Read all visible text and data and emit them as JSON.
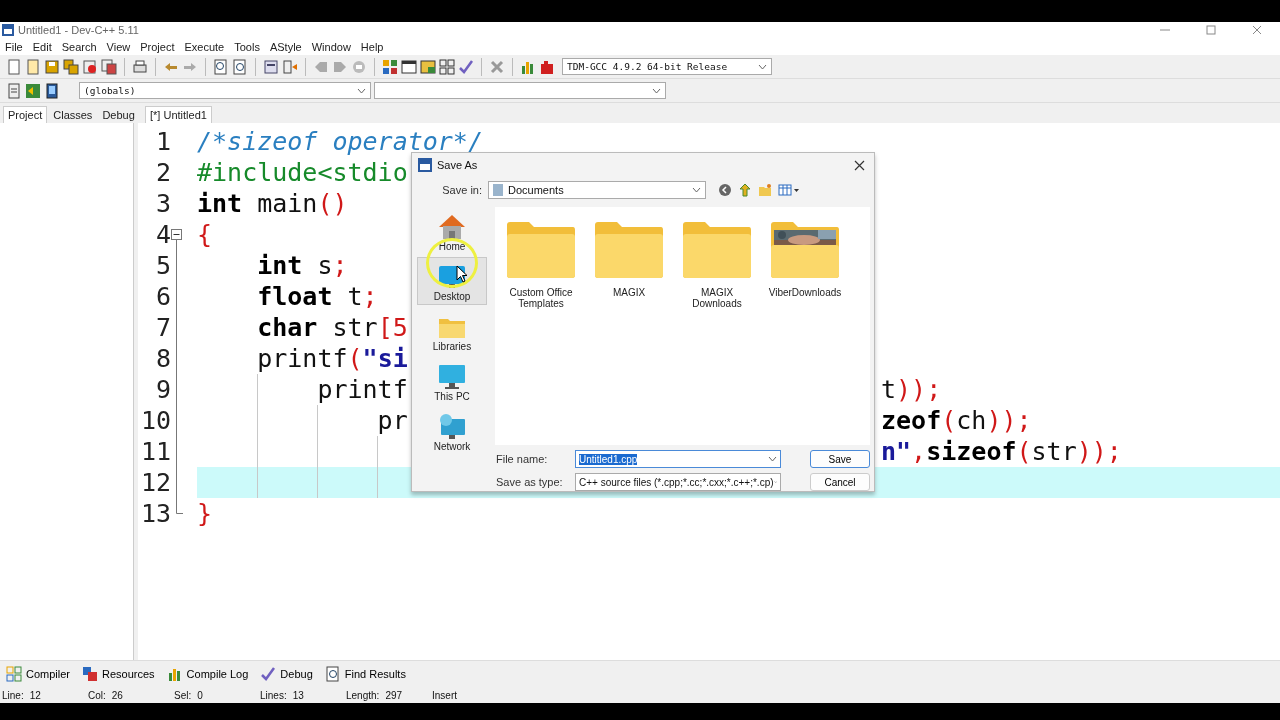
{
  "window": {
    "title": "Untitled1 - Dev-C++ 5.11"
  },
  "menu": [
    "File",
    "Edit",
    "Search",
    "View",
    "Project",
    "Execute",
    "Tools",
    "AStyle",
    "Window",
    "Help"
  ],
  "compiler_select": {
    "value": "TDM-GCC 4.9.2 64-bit Release"
  },
  "scope_select": {
    "value": "(globals)"
  },
  "side_tabs": [
    {
      "label": "Project",
      "selected": true
    },
    {
      "label": "Classes",
      "selected": false
    },
    {
      "label": "Debug",
      "selected": false
    }
  ],
  "editor_tabs": [
    {
      "label": "[*] Untitled1",
      "selected": true
    }
  ],
  "editor": {
    "lines": [
      {
        "number": "1",
        "current": false,
        "left": [
          {
            "kind": "comment",
            "text": "/*sizeof operator*/"
          }
        ]
      },
      {
        "number": "2",
        "current": false,
        "left": [
          {
            "kind": "pre",
            "text": "#include<stdio"
          }
        ]
      },
      {
        "number": "3",
        "current": false,
        "left": [
          {
            "kind": "kw",
            "text": "int"
          },
          {
            "kind": "plain",
            "text": " main"
          },
          {
            "kind": "punct",
            "text": "()"
          }
        ]
      },
      {
        "number": "4",
        "current": false,
        "expanded": true,
        "left": [
          {
            "kind": "punct",
            "text": "{"
          }
        ]
      },
      {
        "number": "5",
        "current": false,
        "left": [
          {
            "kind": "kw",
            "text": "    int"
          },
          {
            "kind": "plain",
            "text": " s"
          },
          {
            "kind": "punct",
            "text": ";"
          }
        ]
      },
      {
        "number": "6",
        "current": false,
        "left": [
          {
            "kind": "kw",
            "text": "    float"
          },
          {
            "kind": "plain",
            "text": " t"
          },
          {
            "kind": "punct",
            "text": ";"
          }
        ]
      },
      {
        "number": "7",
        "current": false,
        "left": [
          {
            "kind": "kw",
            "text": "    char"
          },
          {
            "kind": "plain",
            "text": " str"
          },
          {
            "kind": "punct",
            "text": "[5"
          }
        ]
      },
      {
        "number": "8",
        "current": false,
        "left": [
          {
            "kind": "plain",
            "text": "    printf"
          },
          {
            "kind": "punct",
            "text": "("
          },
          {
            "kind": "str",
            "text": "\"si"
          }
        ]
      },
      {
        "number": "9",
        "current": false,
        "left": [
          {
            "kind": "plain",
            "text": "        printf"
          }
        ],
        "right": [
          {
            "kind": "plain",
            "text": "t"
          },
          {
            "kind": "punct",
            "text": "));"
          }
        ]
      },
      {
        "number": "10",
        "current": false,
        "left": [
          {
            "kind": "plain",
            "text": "            pr"
          }
        ],
        "right": [
          {
            "kind": "kw",
            "text": "zeof"
          },
          {
            "kind": "punct",
            "text": "("
          },
          {
            "kind": "plain",
            "text": "ch"
          },
          {
            "kind": "punct",
            "text": "));"
          }
        ]
      },
      {
        "number": "11",
        "current": false,
        "right": [
          {
            "kind": "str",
            "text": "n\""
          },
          {
            "kind": "punct",
            "text": ","
          },
          {
            "kind": "kw",
            "text": "sizeof"
          },
          {
            "kind": "punct",
            "text": "("
          },
          {
            "kind": "plain",
            "text": "str"
          },
          {
            "kind": "punct",
            "text": "));"
          }
        ]
      },
      {
        "number": "12",
        "current": true
      },
      {
        "number": "13",
        "current": false,
        "left": [
          {
            "kind": "punct",
            "text": "}"
          }
        ]
      }
    ]
  },
  "bottom_tabs": [
    {
      "label": "Compiler"
    },
    {
      "label": "Resources"
    },
    {
      "label": "Compile Log"
    },
    {
      "label": "Debug"
    },
    {
      "label": "Find Results"
    }
  ],
  "status_bar": [
    {
      "label": "Line:",
      "value": "12"
    },
    {
      "label": "Col:",
      "value": "26"
    },
    {
      "label": "Sel:",
      "value": "0"
    },
    {
      "label": "Lines:",
      "value": "13"
    },
    {
      "label": "Length:",
      "value": "297"
    },
    {
      "label": "Insert"
    }
  ],
  "dialog": {
    "title": "Save As",
    "save_in": {
      "label": "Save in:",
      "value": "Documents"
    },
    "places": [
      {
        "kind": "home",
        "label": "Home",
        "selected": false
      },
      {
        "kind": "desktop",
        "label": "Desktop",
        "selected": true
      },
      {
        "kind": "libraries",
        "label": "Libraries",
        "selected": false
      },
      {
        "kind": "pc",
        "label": "This PC",
        "selected": false
      },
      {
        "kind": "network",
        "label": "Network",
        "selected": false
      }
    ],
    "items": [
      {
        "kind": "folder",
        "name": "Custom Office Templates"
      },
      {
        "kind": "folder",
        "name": "MAGIX"
      },
      {
        "kind": "folder",
        "name": "MAGIX Downloads"
      },
      {
        "kind": "picture-folder",
        "name": "ViberDownloads"
      }
    ],
    "file_name": {
      "label": "File name:",
      "value": "Untitled1.cpp",
      "text_selected": true
    },
    "file_type": {
      "label": "Save as type:",
      "value": "C++ source files (*.cpp;*.cc;*.cxx;*.c++;*.cp)"
    },
    "buttons": [
      {
        "kind": "default",
        "label": "Save"
      },
      {
        "kind": "normal",
        "label": "Cancel"
      }
    ]
  }
}
